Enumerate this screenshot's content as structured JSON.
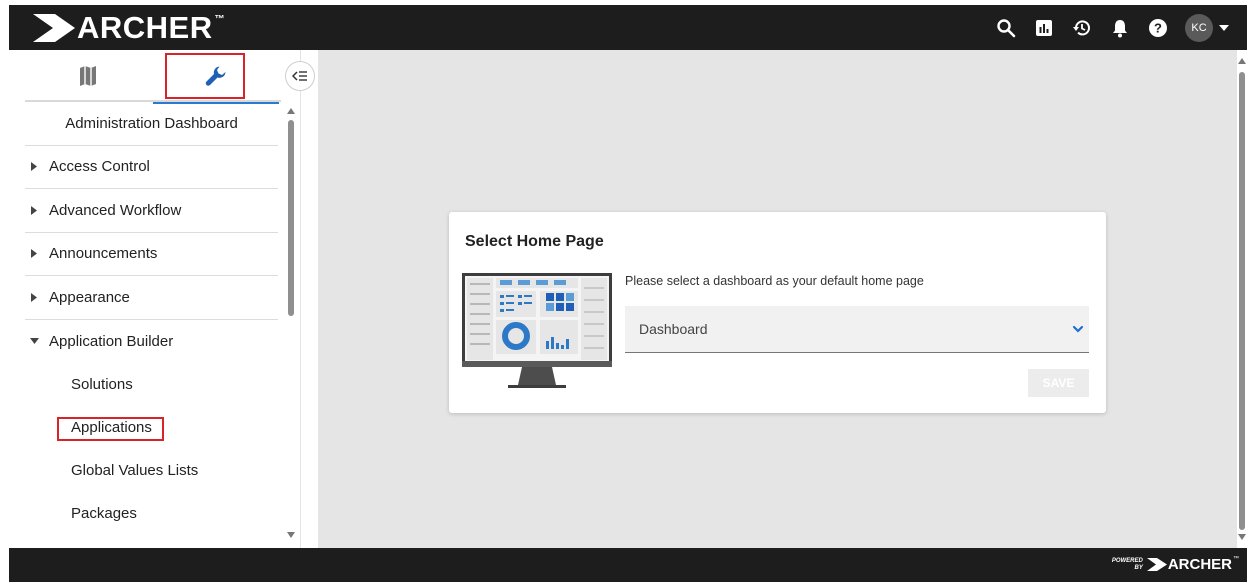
{
  "header": {
    "brand": "ARCHER",
    "brand_tm": "™",
    "avatar_initials": "KC",
    "icons": [
      "search-icon",
      "reports-icon",
      "history-icon",
      "bell-icon",
      "help-icon",
      "chevron-down-icon"
    ]
  },
  "sidebar": {
    "tabs": [
      {
        "name": "map-icon",
        "active": false
      },
      {
        "name": "wrench-icon",
        "active": true
      }
    ],
    "dashboard_label": "Administration Dashboard",
    "items": [
      {
        "label": "Access Control",
        "expanded": false
      },
      {
        "label": "Advanced Workflow",
        "expanded": false
      },
      {
        "label": "Announcements",
        "expanded": false
      },
      {
        "label": "Appearance",
        "expanded": false
      },
      {
        "label": "Application Builder",
        "expanded": true
      }
    ],
    "sub_items": [
      {
        "label": "Solutions"
      },
      {
        "label": "Applications"
      },
      {
        "label": "Global Values Lists"
      },
      {
        "label": "Packages"
      }
    ]
  },
  "card": {
    "title": "Select Home Page",
    "description": "Please select a dashboard as your default home page",
    "select_value": "Dashboard",
    "save_label": "SAVE"
  },
  "footer": {
    "powered_line1": "POWERED",
    "powered_line2": "BY",
    "brand": "ARCHER",
    "brand_tm": "™"
  },
  "colors": {
    "topbar": "#1d1d1d",
    "accent": "#2a7ad2",
    "highlight": "#d8232a",
    "main_bg": "#e5e5e5",
    "chevron": "#1f6fd1"
  }
}
